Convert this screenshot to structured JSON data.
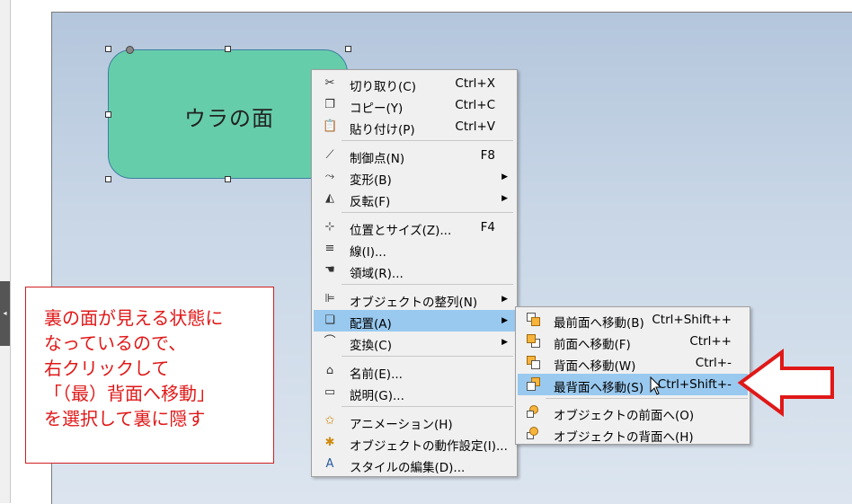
{
  "shape": {
    "label": "ウラの面",
    "fill": "#66cdaa"
  },
  "note": {
    "lines": [
      "裏の面が見える状態に",
      "なっているので、",
      "右クリックして",
      "「（最）背面へ移動」",
      "を選択して裏に隠す"
    ],
    "color": "#e01818"
  },
  "context_menu": {
    "items": [
      {
        "label": "切り取り(C)",
        "shortcut": "Ctrl+X",
        "icon": "scissors-icon"
      },
      {
        "label": "コピー(Y)",
        "shortcut": "Ctrl+C",
        "icon": "copy-icon"
      },
      {
        "label": "貼り付け(P)",
        "shortcut": "Ctrl+V",
        "icon": "paste-icon"
      },
      {
        "label": "制御点(N)",
        "shortcut": "F8",
        "icon": "control-points-icon"
      },
      {
        "label": "変形(B)",
        "shortcut": "",
        "icon": "transform-icon",
        "submenu": true
      },
      {
        "label": "反転(F)",
        "shortcut": "",
        "icon": "flip-icon",
        "submenu": true
      },
      {
        "label": "位置とサイズ(Z)...",
        "shortcut": "F4",
        "icon": "position-size-icon"
      },
      {
        "label": "線(I)...",
        "shortcut": "",
        "icon": "line-icon"
      },
      {
        "label": "領域(R)...",
        "shortcut": "",
        "icon": "area-icon"
      },
      {
        "label": "オブジェクトの整列(N)",
        "shortcut": "",
        "icon": "align-icon",
        "submenu": true
      },
      {
        "label": "配置(A)",
        "shortcut": "",
        "icon": "arrange-icon",
        "submenu": true,
        "highlighted": true
      },
      {
        "label": "変換(C)",
        "shortcut": "",
        "icon": "convert-icon",
        "submenu": true
      },
      {
        "label": "名前(E)...",
        "shortcut": "",
        "icon": "name-icon"
      },
      {
        "label": "説明(G)...",
        "shortcut": "",
        "icon": "description-icon"
      },
      {
        "label": "アニメーション(H)",
        "shortcut": "",
        "icon": "animation-icon"
      },
      {
        "label": "オブジェクトの動作設定(I)...",
        "shortcut": "",
        "icon": "interaction-icon"
      },
      {
        "label": "スタイルの編集(D)...",
        "shortcut": "",
        "icon": "edit-style-icon"
      }
    ]
  },
  "arrange_submenu": {
    "items": [
      {
        "label": "最前面へ移動(B)",
        "shortcut": "Ctrl+Shift++"
      },
      {
        "label": "前面へ移動(F)",
        "shortcut": "Ctrl++"
      },
      {
        "label": "背面へ移動(W)",
        "shortcut": "Ctrl+-"
      },
      {
        "label": "最背面へ移動(S)",
        "shortcut": "Ctrl+Shift+-",
        "highlighted": true
      },
      {
        "label": "オブジェクトの前面へ(O)",
        "shortcut": ""
      },
      {
        "label": "オブジェクトの背面へ(H)",
        "shortcut": ""
      }
    ]
  },
  "colors": {
    "highlight": "#99c9ef",
    "callout_red": "#e01818"
  }
}
